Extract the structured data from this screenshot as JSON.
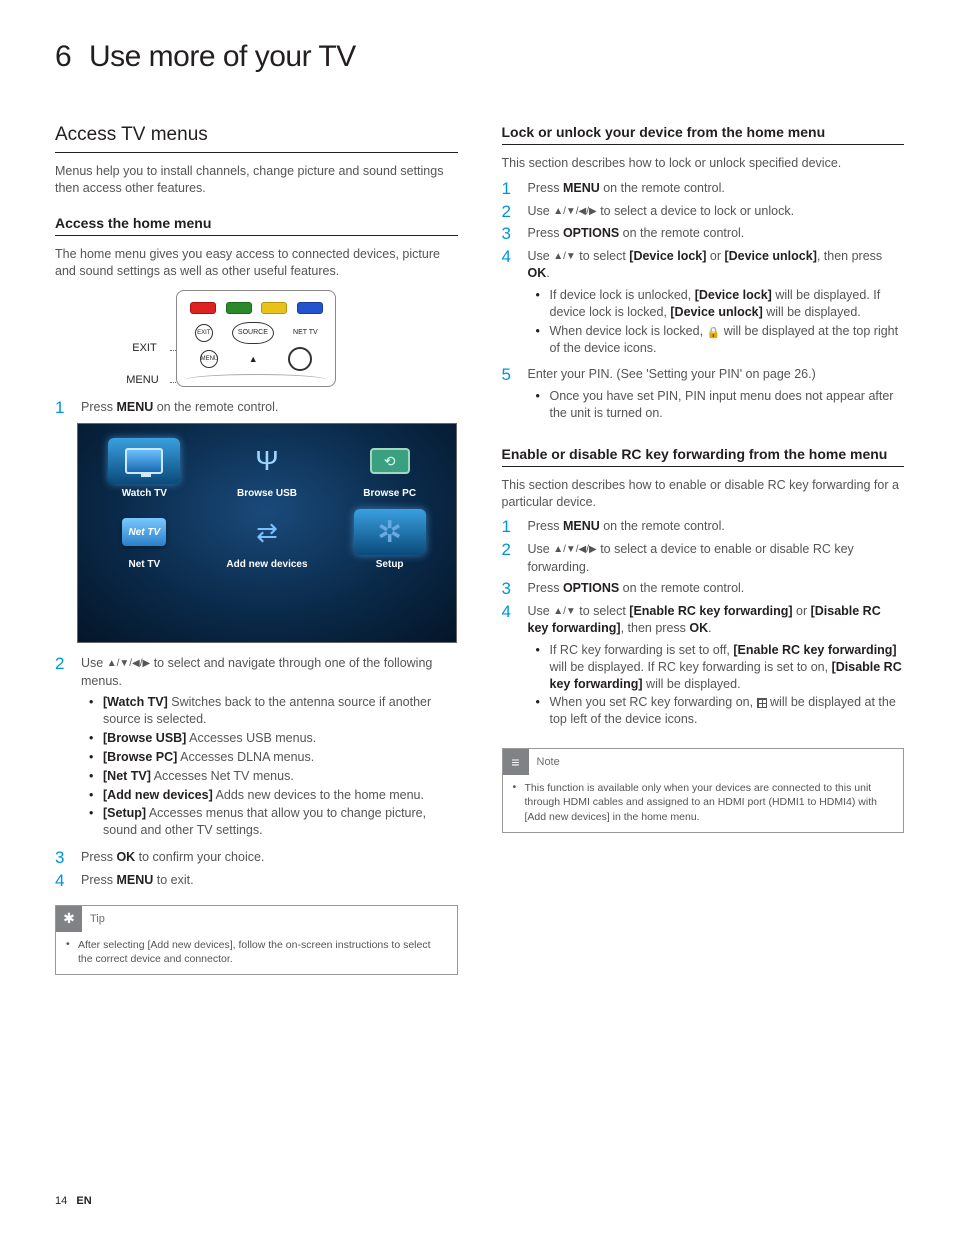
{
  "chapter": {
    "number": "6",
    "title": "Use more of your TV"
  },
  "left": {
    "section": "Access TV menus",
    "intro": "Menus help you to install channels, change picture and sound settings then access other features.",
    "sub1": {
      "title": "Access the home menu",
      "intro": "The home menu gives you easy access to connected devices, picture and sound settings as well as other useful features.",
      "remote": {
        "exit": "EXIT",
        "menu": "MENU",
        "source": "SOURCE",
        "nettv": "NET TV",
        "exit_small": "EXIT",
        "menu_small": "MENU"
      },
      "menuItems": [
        "Watch TV",
        "Browse USB",
        "Browse PC",
        "Net TV",
        "Add new devices",
        "Setup"
      ],
      "steps": [
        {
          "n": "1",
          "pre": "Press ",
          "bold": "MENU",
          "post": " on the remote control."
        },
        {
          "n": "2",
          "pre": "Use ",
          "sym": "▲/▼/◀/▶",
          "post": " to select and navigate through one of the following menus."
        },
        {
          "n": "3",
          "pre": "Press ",
          "bold": "OK",
          "post": " to confirm your choice."
        },
        {
          "n": "4",
          "pre": "Press ",
          "bold": "MENU",
          "post": " to exit."
        }
      ],
      "options": [
        {
          "label": "[Watch TV]",
          "desc": " Switches back to the antenna source if another source is selected."
        },
        {
          "label": "[Browse USB]",
          "desc": " Accesses USB menus."
        },
        {
          "label": "[Browse PC]",
          "desc": " Accesses DLNA menus."
        },
        {
          "label": "[Net TV]",
          "desc": " Accesses Net TV menus."
        },
        {
          "label": "[Add new devices]",
          "desc": " Adds new devices to the home menu."
        },
        {
          "label": "[Setup]",
          "desc": " Accesses menus that allow you to change picture, sound and other TV settings."
        }
      ],
      "tip": {
        "title": "Tip",
        "pre": "After selecting ",
        "bold": "[Add new devices]",
        "post": ", follow the on-screen instructions to select the correct device and connector."
      }
    }
  },
  "right": {
    "lock": {
      "title": "Lock or unlock your device from the home menu",
      "intro": "This section describes how to lock or unlock specified device.",
      "steps": {
        "s1": {
          "n": "1",
          "pre": "Press ",
          "bold": "MENU",
          "post": " on the remote control."
        },
        "s2": {
          "n": "2",
          "pre": "Use ",
          "sym": "▲/▼/◀/▶",
          "post": " to select a device to lock or unlock."
        },
        "s3": {
          "n": "3",
          "pre": "Press ",
          "bold": "OPTIONS",
          "post": " on the remote control."
        },
        "s4": {
          "n": "4",
          "t1": "Use ",
          "sym": "▲/▼",
          "t2": " to select ",
          "b1": "[Device lock]",
          "t3": " or ",
          "b2": "[Device unlock]",
          "t4": ", then press ",
          "b3": "OK",
          "t5": "."
        },
        "s4b1": {
          "pre": "If device lock is unlocked, ",
          "bold": "[Device lock]",
          "post": " will be displayed. If device lock is locked, ",
          "bold2": "[Device unlock]",
          "post2": " will be displayed."
        },
        "s4b2": {
          "pre": "When device lock is locked, ",
          "post": " will be displayed at the top right of the device icons."
        },
        "s5": {
          "n": "5",
          "text": "Enter your PIN. (See 'Setting your PIN' on page 26.)"
        },
        "s5b1": "Once you have set PIN, PIN input menu does not appear after the unit is turned on."
      }
    },
    "rc": {
      "title": "Enable or disable RC key forwarding from the home menu",
      "intro": "This section describes how to enable or disable RC key forwarding for a particular device.",
      "steps": {
        "s1": {
          "n": "1",
          "pre": "Press ",
          "bold": "MENU",
          "post": " on the remote control."
        },
        "s2": {
          "n": "2",
          "pre": "Use ",
          "sym": "▲/▼/◀/▶",
          "post": " to select a device to enable or disable RC key forwarding."
        },
        "s3": {
          "n": "3",
          "pre": "Press ",
          "bold": "OPTIONS",
          "post": " on the remote control."
        },
        "s4": {
          "n": "4",
          "t1": "Use ",
          "sym": "▲/▼",
          "t2": " to select ",
          "b1": "[Enable RC key forwarding]",
          "t3": " or ",
          "b2": "[Disable RC key forwarding]",
          "t4": ", then press ",
          "b3": "OK",
          "t5": "."
        },
        "s4b1": {
          "t1": "If RC key forwarding is set to off, ",
          "b1": "[Enable RC key forwarding]",
          "t2": " will be displayed. If RC key forwarding is set to on, ",
          "b2": "[Disable RC key forwarding]",
          "t3": " will be displayed."
        },
        "s4b2": {
          "pre": "When you set RC key forwarding on, ",
          "post": " will be displayed at the top left of the device icons."
        }
      },
      "note": {
        "title": "Note",
        "pre": "This function is available only when your devices are connected to this unit through HDMI cables and assigned to an HDMI port (HDMI1 to HDMI4) with ",
        "bold": "[Add new devices]",
        "post": " in the home menu."
      }
    }
  },
  "footer": {
    "page": "14",
    "lang": "EN"
  }
}
